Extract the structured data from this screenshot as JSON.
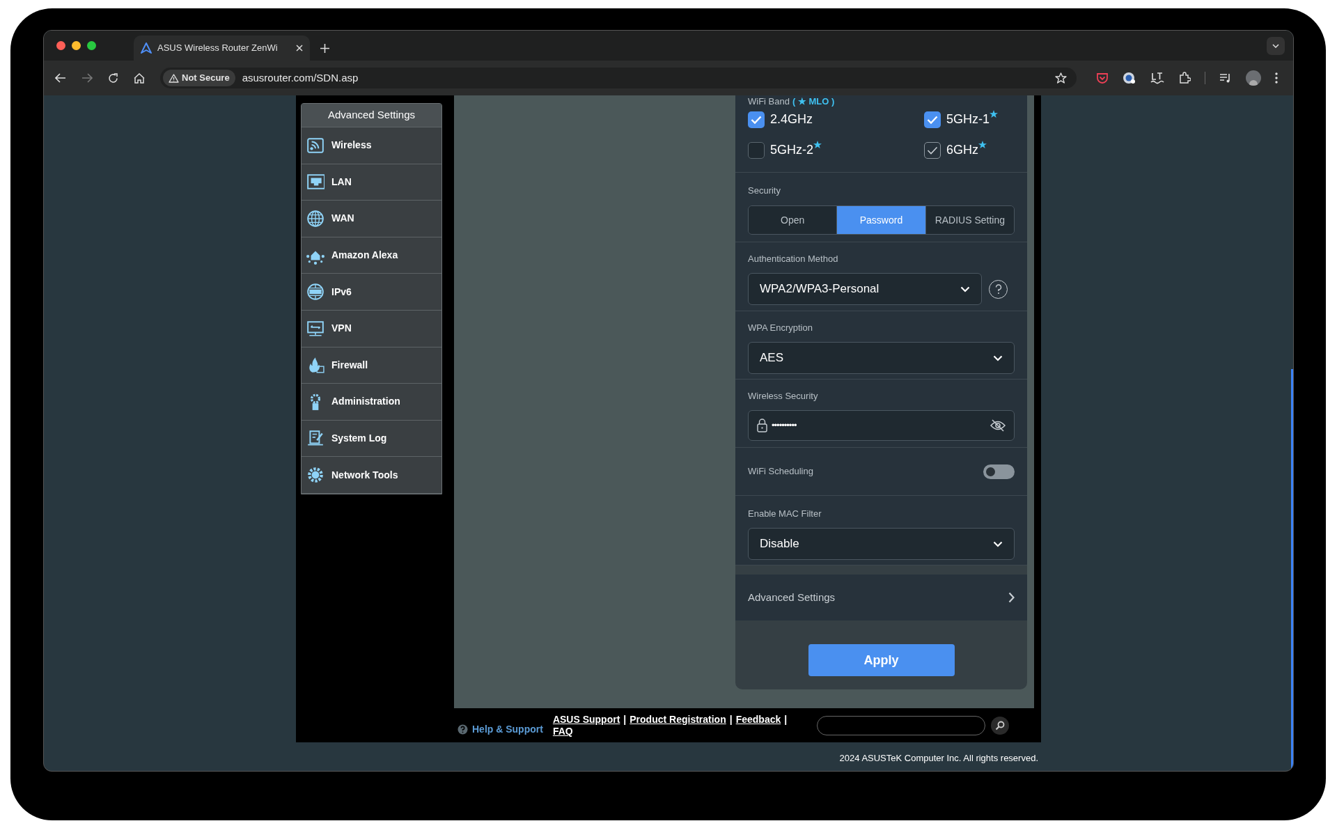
{
  "browser": {
    "tab": {
      "title": "ASUS Wireless Router ZenWi"
    },
    "address_bar": {
      "security": "Not Secure",
      "url": "asusrouter.com/SDN.asp"
    }
  },
  "sidebar": {
    "header": "Advanced Settings",
    "items": [
      {
        "label": "Wireless"
      },
      {
        "label": "LAN"
      },
      {
        "label": "WAN"
      },
      {
        "label": "Amazon Alexa"
      },
      {
        "label": "IPv6"
      },
      {
        "label": "VPN"
      },
      {
        "label": "Firewall"
      },
      {
        "label": "Administration"
      },
      {
        "label": "System Log"
      },
      {
        "label": "Network Tools"
      }
    ]
  },
  "wifi_band": {
    "label": "WiFi Band",
    "mlo": "( ★ MLO )",
    "bands": [
      {
        "label": "2.4GHz",
        "checked": true,
        "disabled": false,
        "mlo": false
      },
      {
        "label": "5GHz-1",
        "checked": true,
        "disabled": false,
        "mlo": true
      },
      {
        "label": "5GHz-2",
        "checked": false,
        "disabled": false,
        "mlo": true
      },
      {
        "label": "6GHz",
        "checked": true,
        "disabled": true,
        "mlo": true
      }
    ]
  },
  "security": {
    "label": "Security",
    "options": [
      {
        "label": "Open",
        "selected": false
      },
      {
        "label": "Password",
        "selected": true
      },
      {
        "label": "RADIUS Setting",
        "selected": false
      }
    ]
  },
  "authentication": {
    "label": "Authentication Method",
    "value": "WPA2/WPA3-Personal"
  },
  "encryption": {
    "label": "WPA Encryption",
    "value": "AES"
  },
  "wireless_security": {
    "label": "Wireless Security",
    "value": "••••••••••"
  },
  "wifi_scheduling": {
    "label": "WiFi Scheduling",
    "on": false
  },
  "mac_filter": {
    "label": "Enable MAC Filter",
    "value": "Disable"
  },
  "advanced": {
    "label": "Advanced Settings"
  },
  "apply": "Apply",
  "footer": {
    "help": "Help & Support",
    "links": [
      {
        "label": "ASUS Support",
        "separator": "|"
      },
      {
        "label": "Product Registration",
        "separator": "|"
      },
      {
        "label": "Feedback",
        "separator": "|"
      },
      {
        "label": "FAQ"
      }
    ],
    "copyright": "2024 ASUSTeK Computer Inc. All rights reserved."
  }
}
